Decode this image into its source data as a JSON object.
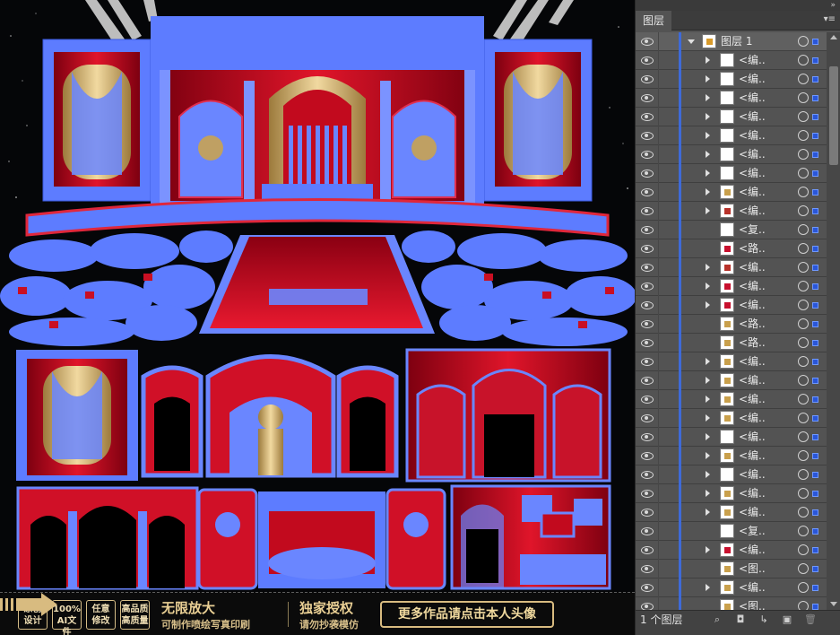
{
  "panel": {
    "tab_label": "图层",
    "collapse_icon": "double-chevron-right-icon",
    "menu_icon": "panel-menu-icon",
    "footer": {
      "layer_count": "1 个图层",
      "icons": [
        "locate-object-icon",
        "make-clipping-mask-icon",
        "new-sublayer-icon",
        "new-layer-icon",
        "delete-layer-icon"
      ]
    },
    "layers": [
      {
        "name": "图层 1",
        "level": 0,
        "expanded": true,
        "thumb": "gold-orange"
      },
      {
        "name": "<编..",
        "level": 1,
        "thumb": "white"
      },
      {
        "name": "<编..",
        "level": 1,
        "thumb": "white"
      },
      {
        "name": "<编..",
        "level": 1,
        "thumb": "white"
      },
      {
        "name": "<编..",
        "level": 1,
        "thumb": "white"
      },
      {
        "name": "<编..",
        "level": 1,
        "thumb": "white"
      },
      {
        "name": "<编..",
        "level": 1,
        "thumb": "white"
      },
      {
        "name": "<编..",
        "level": 1,
        "thumb": "white"
      },
      {
        "name": "<编..",
        "level": 1,
        "thumb": "gold"
      },
      {
        "name": "<编..",
        "level": 1,
        "thumb": "red-gold"
      },
      {
        "name": "<复..",
        "level": 1,
        "thumb": "white",
        "no_arrow": true
      },
      {
        "name": "<路..",
        "level": 1,
        "thumb": "red",
        "no_arrow": true
      },
      {
        "name": "<编..",
        "level": 1,
        "thumb": "red-gold"
      },
      {
        "name": "<编..",
        "level": 1,
        "thumb": "red"
      },
      {
        "name": "<编..",
        "level": 1,
        "thumb": "red"
      },
      {
        "name": "<路..",
        "level": 1,
        "thumb": "gold",
        "no_arrow": true
      },
      {
        "name": "<路..",
        "level": 1,
        "thumb": "gold",
        "no_arrow": true
      },
      {
        "name": "<编..",
        "level": 1,
        "thumb": "gold"
      },
      {
        "name": "<编..",
        "level": 1,
        "thumb": "gold"
      },
      {
        "name": "<编..",
        "level": 1,
        "thumb": "gold"
      },
      {
        "name": "<编..",
        "level": 1,
        "thumb": "gold"
      },
      {
        "name": "<编..",
        "level": 1,
        "thumb": "white"
      },
      {
        "name": "<编..",
        "level": 1,
        "thumb": "gold"
      },
      {
        "name": "<编..",
        "level": 1,
        "thumb": "white"
      },
      {
        "name": "<编..",
        "level": 1,
        "thumb": "gold"
      },
      {
        "name": "<编..",
        "level": 1,
        "thumb": "gold"
      },
      {
        "name": "<复..",
        "level": 1,
        "thumb": "white",
        "no_arrow": true
      },
      {
        "name": "<编..",
        "level": 1,
        "thumb": "red"
      },
      {
        "name": "<图..",
        "level": 1,
        "thumb": "gold",
        "no_arrow": true
      },
      {
        "name": "<编..",
        "level": 1,
        "thumb": "gold"
      },
      {
        "name": "<图..",
        "level": 1,
        "thumb": "gold",
        "no_arrow": true
      }
    ]
  },
  "banner": {
    "badges": [
      {
        "line1": "原创",
        "line2": "设计"
      },
      {
        "line1": "100%",
        "line2": "AI文件"
      },
      {
        "line1": "任意",
        "line2": "修改"
      },
      {
        "line1": "高品质",
        "line2": "高质量"
      }
    ],
    "headline1": "无限放大",
    "subline1": "可制作喷绘写真印刷",
    "headline2": "独家授权",
    "subline2": "请勿抄袭模仿",
    "cta": "更多作品请点击本人头像"
  },
  "colors": {
    "selection_blue": "#4f7cff",
    "wedding_red": "#c4081c",
    "gold": "#d4b06a",
    "panel_bg": "#535353"
  }
}
